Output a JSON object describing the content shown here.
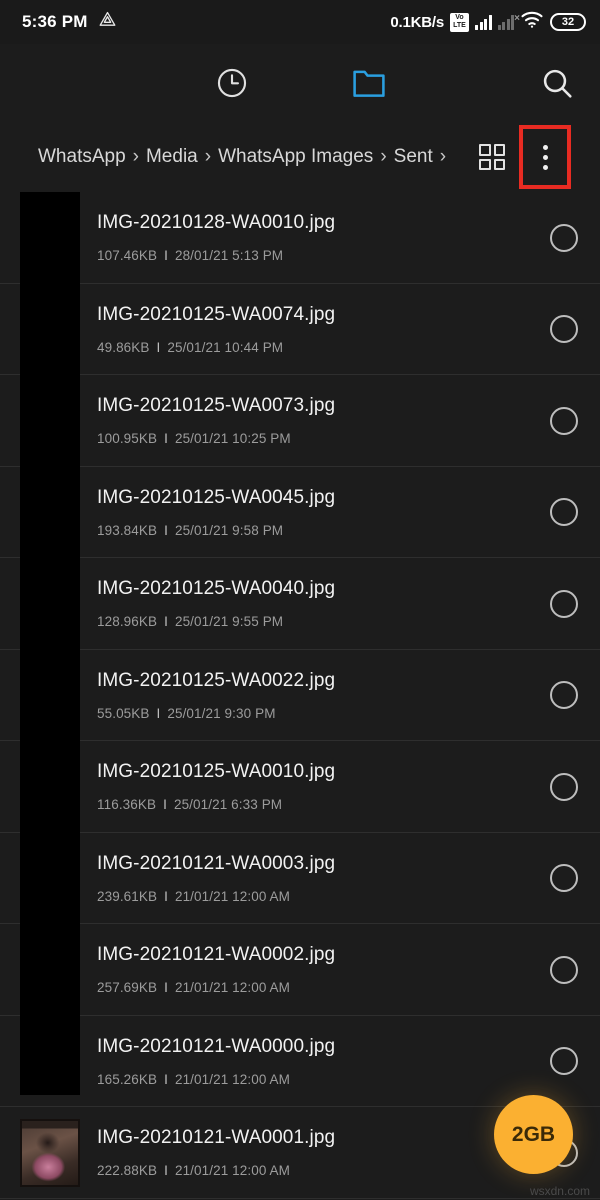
{
  "status_bar": {
    "clock": "5:36 PM",
    "left_icon": "drive-triangle-icon",
    "network_speed": "0.1KB/s",
    "volte_top": "Vo",
    "volte_bottom": "LTE",
    "sim2_x": "×",
    "battery_level": "32",
    "wifi_icon": "wifi-icon"
  },
  "toolbar": {
    "menu_icon": "hamburger-menu-icon",
    "recent_icon": "clock-recent-icon",
    "folder_icon": "folder-icon",
    "search_icon": "search-icon",
    "folder_active_color": "#2a9fe0"
  },
  "breadcrumb": {
    "items": [
      "WhatsApp",
      "Media",
      "WhatsApp Images",
      "Sent"
    ],
    "separator": "›",
    "trailing_separator": "›",
    "grid_view_icon": "grid-view-icon",
    "overflow_icon": "three-dot-menu-icon",
    "highlight_color": "#e82b22"
  },
  "files": [
    {
      "name": "IMG-20210128-WA0010.jpg",
      "size": "107.46KB",
      "divider": "I",
      "date": "28/01/21 5:13 PM",
      "thumb": "redacted"
    },
    {
      "name": "IMG-20210125-WA0074.jpg",
      "size": "49.86KB",
      "divider": "I",
      "date": "25/01/21 10:44 PM",
      "thumb": "redacted"
    },
    {
      "name": "IMG-20210125-WA0073.jpg",
      "size": "100.95KB",
      "divider": "I",
      "date": "25/01/21 10:25 PM",
      "thumb": "redacted"
    },
    {
      "name": "IMG-20210125-WA0045.jpg",
      "size": "193.84KB",
      "divider": "I",
      "date": "25/01/21 9:58 PM",
      "thumb": "redacted"
    },
    {
      "name": "IMG-20210125-WA0040.jpg",
      "size": "128.96KB",
      "divider": "I",
      "date": "25/01/21 9:55 PM",
      "thumb": "redacted"
    },
    {
      "name": "IMG-20210125-WA0022.jpg",
      "size": "55.05KB",
      "divider": "I",
      "date": "25/01/21 9:30 PM",
      "thumb": "redacted"
    },
    {
      "name": "IMG-20210125-WA0010.jpg",
      "size": "116.36KB",
      "divider": "I",
      "date": "25/01/21 6:33 PM",
      "thumb": "redacted"
    },
    {
      "name": "IMG-20210121-WA0003.jpg",
      "size": "239.61KB",
      "divider": "I",
      "date": "21/01/21 12:00 AM",
      "thumb": "redacted"
    },
    {
      "name": "IMG-20210121-WA0002.jpg",
      "size": "257.69KB",
      "divider": "I",
      "date": "21/01/21 12:00 AM",
      "thumb": "redacted"
    },
    {
      "name": "IMG-20210121-WA0000.jpg",
      "size": "165.26KB",
      "divider": "I",
      "date": "21/01/21 12:00 AM",
      "thumb": "redacted"
    },
    {
      "name": "IMG-20210121-WA0001.jpg",
      "size": "222.88KB",
      "divider": "I",
      "date": "21/01/21 12:00 AM",
      "thumb": "photo"
    }
  ],
  "fab": {
    "label": "2GB",
    "color": "#fbb031"
  },
  "watermark": "wsxdn.com"
}
